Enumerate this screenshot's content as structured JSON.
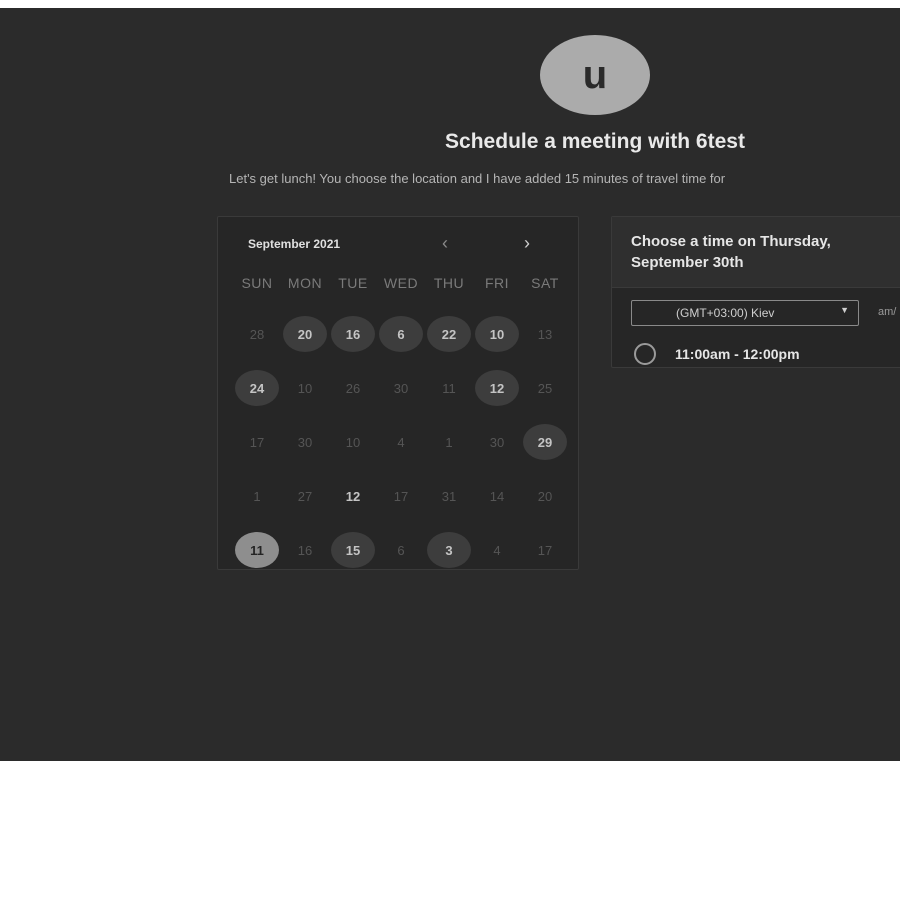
{
  "profile": {
    "avatar_letter": "u"
  },
  "header": {
    "title": "Schedule a meeting with 6test",
    "description": "Let's get lunch! You choose the location and I have added 15 minutes of travel time for"
  },
  "calendar": {
    "month_label": "September 2021",
    "prev_icon": "‹",
    "next_icon": "›",
    "weekdays": [
      "SUN",
      "MON",
      "TUE",
      "WED",
      "THU",
      "FRI",
      "SAT"
    ],
    "days": [
      {
        "label": "28",
        "state": "muted"
      },
      {
        "label": "20",
        "state": "available"
      },
      {
        "label": "16",
        "state": "available"
      },
      {
        "label": "6",
        "state": "available"
      },
      {
        "label": "22",
        "state": "available"
      },
      {
        "label": "10",
        "state": "available"
      },
      {
        "label": "13",
        "state": "muted"
      },
      {
        "label": "24",
        "state": "available"
      },
      {
        "label": "10",
        "state": "muted"
      },
      {
        "label": "26",
        "state": "muted"
      },
      {
        "label": "30",
        "state": "muted"
      },
      {
        "label": "11",
        "state": "muted"
      },
      {
        "label": "12",
        "state": "available"
      },
      {
        "label": "25",
        "state": "muted"
      },
      {
        "label": "17",
        "state": "muted"
      },
      {
        "label": "30",
        "state": "muted"
      },
      {
        "label": "10",
        "state": "muted"
      },
      {
        "label": "4",
        "state": "muted"
      },
      {
        "label": "1",
        "state": "muted"
      },
      {
        "label": "30",
        "state": "muted"
      },
      {
        "label": "29",
        "state": "available"
      },
      {
        "label": "1",
        "state": "muted"
      },
      {
        "label": "27",
        "state": "muted"
      },
      {
        "label": "12",
        "state": "bold"
      },
      {
        "label": "17",
        "state": "muted"
      },
      {
        "label": "31",
        "state": "muted"
      },
      {
        "label": "14",
        "state": "muted"
      },
      {
        "label": "20",
        "state": "muted"
      },
      {
        "label": "11",
        "state": "selected"
      },
      {
        "label": "16",
        "state": "muted"
      },
      {
        "label": "15",
        "state": "available"
      },
      {
        "label": "6",
        "state": "muted"
      },
      {
        "label": "3",
        "state": "available"
      },
      {
        "label": "4",
        "state": "muted"
      },
      {
        "label": "17",
        "state": "muted"
      }
    ]
  },
  "time_panel": {
    "heading": "Choose a time on Thursday, September 30th",
    "timezone": "(GMT+03:00) Kiev",
    "format_toggle": "am/",
    "slots": [
      {
        "label": "11:00am - 12:00pm",
        "selected": false
      }
    ]
  },
  "colors": {
    "background": "#2b2b2b",
    "panel": "#262626",
    "available_day": "#3d3d3d",
    "selected_day": "#8e8e8e",
    "avatar": "#ababab"
  }
}
